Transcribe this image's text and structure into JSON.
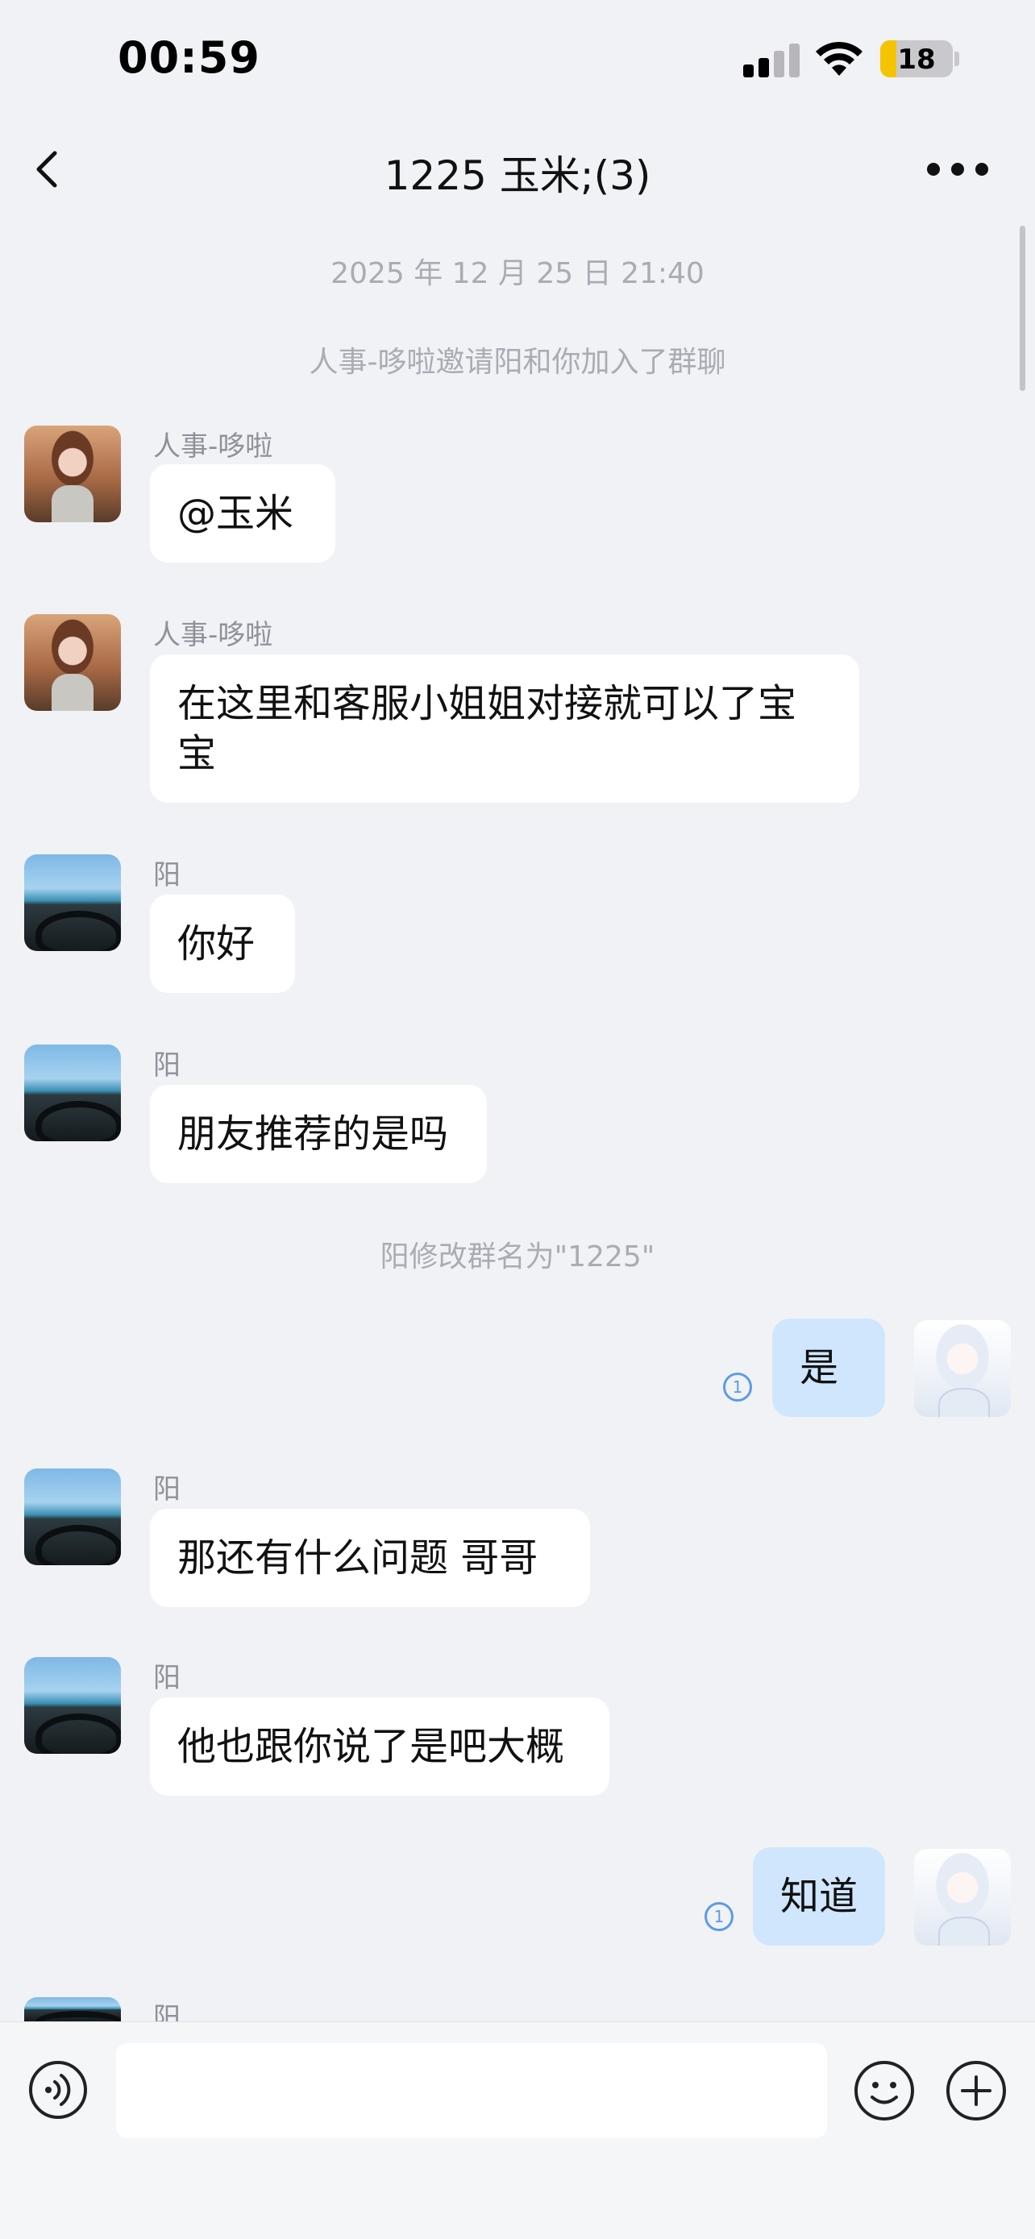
{
  "status": {
    "time": "00:59",
    "battery": "18"
  },
  "nav": {
    "title": "1225 玉米;(3)"
  },
  "system": {
    "timestamp": "2025 年 12 月 25 日 21:40",
    "invite": "人事-哆啦邀请阳和你加入了群聊",
    "rename": "阳修改群名为\"1225\""
  },
  "messages": [
    {
      "sender": "人事-哆啦",
      "text": "@玉米"
    },
    {
      "sender": "人事-哆啦",
      "text": "在这里和客服小姐姐对接就可以了宝宝"
    },
    {
      "sender": "阳",
      "text": "你好"
    },
    {
      "sender": "阳",
      "text": "朋友推荐的是吗"
    },
    {
      "sender": "",
      "text": "是",
      "read": "1"
    },
    {
      "sender": "阳",
      "text": "那还有什么问题 哥哥"
    },
    {
      "sender": "阳",
      "text": "他也跟你说了是吧大概"
    },
    {
      "sender": "",
      "text": "知道",
      "read": "1"
    },
    {
      "sender": "阳",
      "text": ""
    }
  ],
  "composer": {
    "placeholder": ""
  },
  "icons": {
    "back": "chevron-left-icon",
    "more": "more-dots-icon",
    "voice": "voice-icon",
    "emoji": "emoji-icon",
    "plus": "plus-icon"
  },
  "colors": {
    "self_bubble": "#cfe6fd",
    "background": "#f1f2f6",
    "read_indicator": "#5b9be8"
  }
}
